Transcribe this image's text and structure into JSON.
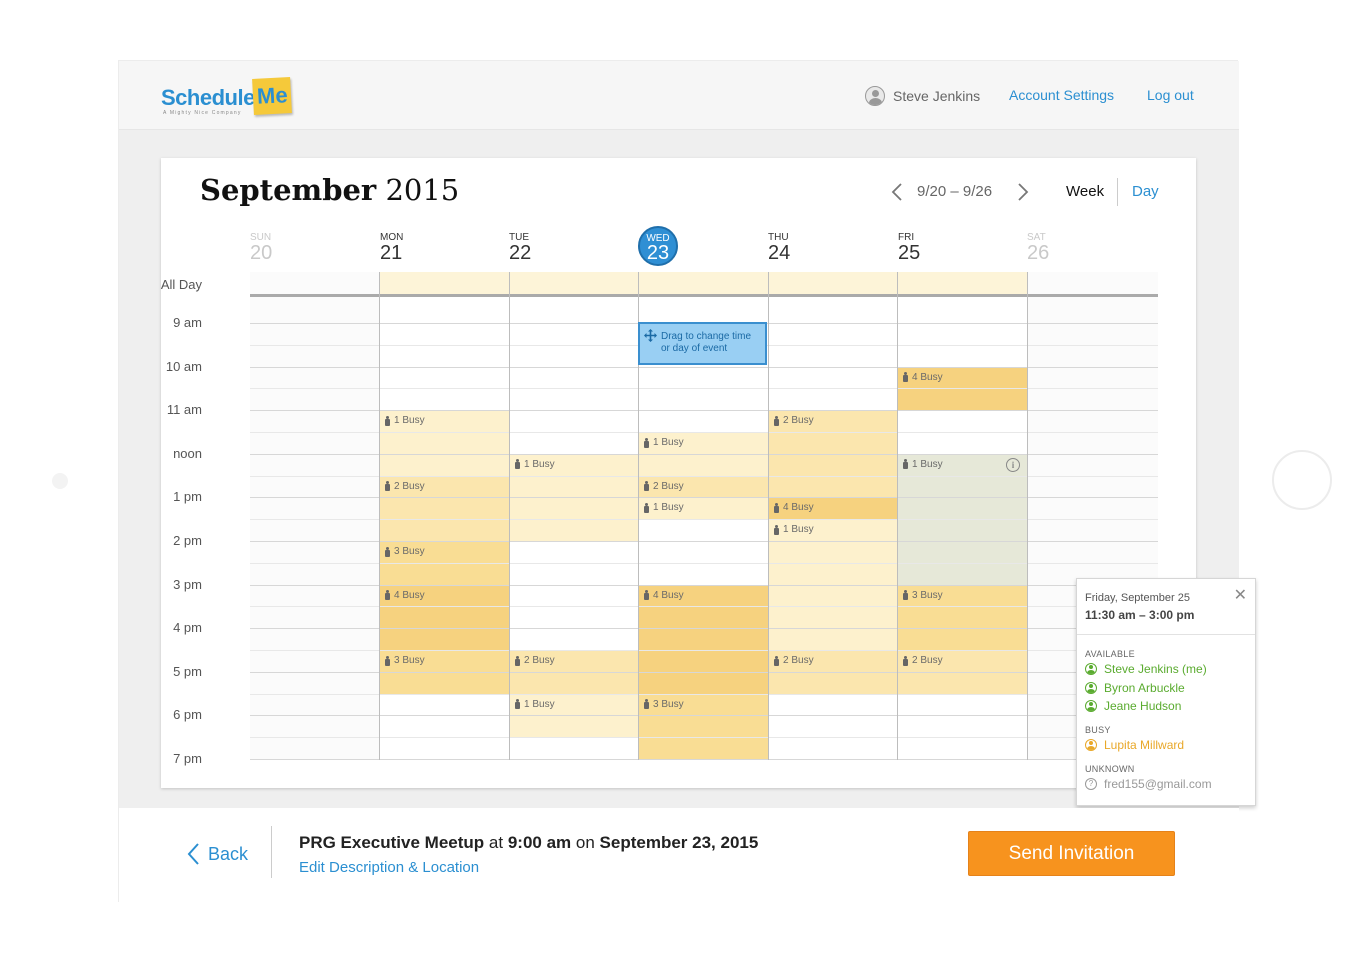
{
  "header": {
    "logo_main": "Schedule",
    "logo_note": "Me",
    "logo_tagline": "A Mighty Nice Company",
    "user_name": "Steve Jenkins",
    "account_settings": "Account Settings",
    "logout": "Log out"
  },
  "calendar": {
    "month": "September",
    "year": "2015",
    "range": "9/20 – 9/26",
    "view_week": "Week",
    "view_day": "Day",
    "all_day_label": "All Day",
    "days": [
      {
        "dow": "SUN",
        "num": "20"
      },
      {
        "dow": "MON",
        "num": "21"
      },
      {
        "dow": "TUE",
        "num": "22"
      },
      {
        "dow": "WED",
        "num": "23"
      },
      {
        "dow": "THU",
        "num": "24"
      },
      {
        "dow": "FRI",
        "num": "25"
      },
      {
        "dow": "SAT",
        "num": "26"
      }
    ],
    "times": [
      "9 am",
      "10 am",
      "11 am",
      "noon",
      "1 pm",
      "2 pm",
      "3 pm",
      "4 pm",
      "5 pm",
      "6 pm",
      "7 pm"
    ],
    "colors": {
      "busy1": "#fdf1cd",
      "busy2": "#fbe6ae",
      "busy3": "#f9dd94",
      "busy4": "#f6d27f",
      "allday": "#fdf4d8",
      "popover_range": "#e6e8d8"
    },
    "busy_blocks": [
      {
        "day": 5,
        "start": 1.0,
        "end": 2.0,
        "level": 4
      },
      {
        "day": 1,
        "start": 2.0,
        "end": 2.5,
        "level": 1
      },
      {
        "day": 1,
        "start": 2.5,
        "end": 3.0,
        "level": 1
      },
      {
        "day": 3,
        "start": 2.0,
        "end": 2.5,
        "level": 0
      },
      {
        "day": 3,
        "start": 2.5,
        "end": 3.0,
        "level": 1
      },
      {
        "day": 4,
        "start": 2.0,
        "end": 3.0,
        "level": 2
      },
      {
        "day": 1,
        "start": 3.0,
        "end": 3.5,
        "level": 1
      },
      {
        "day": 2,
        "start": 3.0,
        "end": 3.5,
        "level": 1
      },
      {
        "day": 3,
        "start": 3.0,
        "end": 3.5,
        "level": 1
      },
      {
        "day": 4,
        "start": 3.0,
        "end": 3.5,
        "level": 2
      },
      {
        "day": 1,
        "start": 3.5,
        "end": 5.0,
        "level": 2
      },
      {
        "day": 2,
        "start": 3.5,
        "end": 5.0,
        "level": 1
      },
      {
        "day": 3,
        "start": 3.5,
        "end": 4.0,
        "level": 2
      },
      {
        "day": 3,
        "start": 4.0,
        "end": 4.5,
        "level": 1
      },
      {
        "day": 4,
        "start": 3.5,
        "end": 4.0,
        "level": 2
      },
      {
        "day": 4,
        "start": 4.0,
        "end": 4.5,
        "level": 4
      },
      {
        "day": 4,
        "start": 4.5,
        "end": 5.0,
        "level": 1
      },
      {
        "day": 1,
        "start": 5.0,
        "end": 6.0,
        "level": 3
      },
      {
        "day": 4,
        "start": 5.0,
        "end": 6.0,
        "level": 1
      },
      {
        "day": 1,
        "start": 6.0,
        "end": 7.5,
        "level": 4
      },
      {
        "day": 3,
        "start": 6.0,
        "end": 7.5,
        "level": 4
      },
      {
        "day": 4,
        "start": 6.0,
        "end": 7.5,
        "level": 1
      },
      {
        "day": 5,
        "start": 6.0,
        "end": 7.5,
        "level": 3
      },
      {
        "day": 1,
        "start": 7.5,
        "end": 8.5,
        "level": 3
      },
      {
        "day": 2,
        "start": 7.5,
        "end": 8.5,
        "level": 2
      },
      {
        "day": 3,
        "start": 7.5,
        "end": 8.5,
        "level": 4
      },
      {
        "day": 4,
        "start": 7.5,
        "end": 8.5,
        "level": 2
      },
      {
        "day": 5,
        "start": 7.5,
        "end": 8.5,
        "level": 2
      },
      {
        "day": 2,
        "start": 8.5,
        "end": 9.5,
        "level": 1
      },
      {
        "day": 3,
        "start": 8.5,
        "end": 10.0,
        "level": 3
      }
    ],
    "busy_labels": [
      {
        "day": 5,
        "at": 1.0,
        "text": "4 Busy"
      },
      {
        "day": 1,
        "at": 2.0,
        "text": "1 Busy"
      },
      {
        "day": 4,
        "at": 2.0,
        "text": "2 Busy"
      },
      {
        "day": 3,
        "at": 2.5,
        "text": "1 Busy"
      },
      {
        "day": 2,
        "at": 3.0,
        "text": "1 Busy"
      },
      {
        "day": 5,
        "at": 3.0,
        "text": "1 Busy"
      },
      {
        "day": 1,
        "at": 3.5,
        "text": "2 Busy"
      },
      {
        "day": 3,
        "at": 3.5,
        "text": "2 Busy"
      },
      {
        "day": 4,
        "at": 4.0,
        "text": "4 Busy"
      },
      {
        "day": 3,
        "at": 4.0,
        "text": "1 Busy"
      },
      {
        "day": 4,
        "at": 4.5,
        "text": "1 Busy"
      },
      {
        "day": 1,
        "at": 5.0,
        "text": "3 Busy"
      },
      {
        "day": 1,
        "at": 6.0,
        "text": "4 Busy"
      },
      {
        "day": 3,
        "at": 6.0,
        "text": "4 Busy"
      },
      {
        "day": 5,
        "at": 6.0,
        "text": "3 Busy"
      },
      {
        "day": 1,
        "at": 7.5,
        "text": "3 Busy"
      },
      {
        "day": 2,
        "at": 7.5,
        "text": "2 Busy"
      },
      {
        "day": 4,
        "at": 7.5,
        "text": "2 Busy"
      },
      {
        "day": 5,
        "at": 7.5,
        "text": "2 Busy"
      },
      {
        "day": 2,
        "at": 8.5,
        "text": "1 Busy"
      },
      {
        "day": 3,
        "at": 8.5,
        "text": "3 Busy"
      }
    ],
    "event": {
      "line1": "Drag to change time",
      "line2": "or day of event"
    },
    "popover": {
      "date": "Friday, September 25",
      "time": "11:30 am – 3:00 pm",
      "available_label": "AVAILABLE",
      "available": [
        "Steve Jenkins (me)",
        "Byron Arbuckle",
        "Jeane Hudson"
      ],
      "busy_label": "BUSY",
      "busy": [
        "Lupita Millward"
      ],
      "unknown_label": "UNKNOWN",
      "unknown": [
        "fred155@gmail.com"
      ],
      "colors": {
        "available": "#5aab2f",
        "busy": "#e9a829",
        "unknown": "#999999"
      }
    }
  },
  "bottom": {
    "back": "Back",
    "event_name": "PRG Executive Meetup",
    "at": "at",
    "time": "9:00 am",
    "on": "on",
    "date": "September 23, 2015",
    "edit_link": "Edit Description & Location",
    "send_button": "Send Invitation"
  }
}
